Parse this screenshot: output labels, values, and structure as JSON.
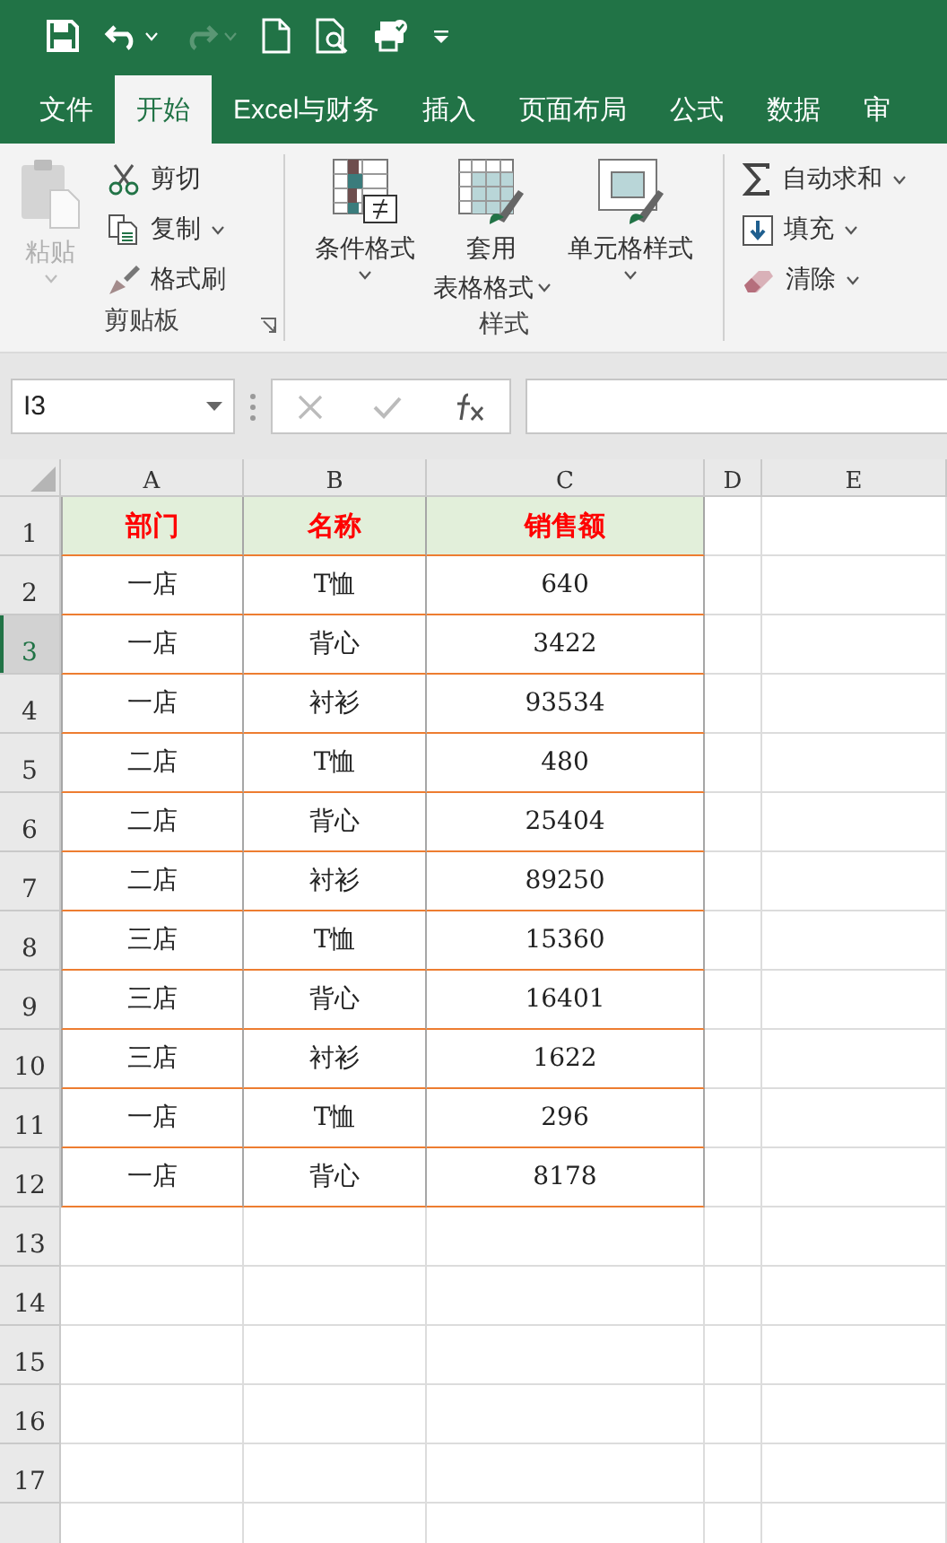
{
  "tabs": [
    {
      "label": "文件",
      "selected": false
    },
    {
      "label": "开始",
      "selected": true
    },
    {
      "label": "Excel与财务",
      "selected": false
    },
    {
      "label": "插入",
      "selected": false
    },
    {
      "label": "页面布局",
      "selected": false
    },
    {
      "label": "公式",
      "selected": false
    },
    {
      "label": "数据",
      "selected": false
    },
    {
      "label": "审",
      "selected": false
    }
  ],
  "ribbon": {
    "groups": [
      {
        "kind": "clipboard",
        "label": "剪贴板",
        "items": [
          {
            "lines": [
              "粘贴"
            ],
            "kind": "large",
            "disabled": true,
            "has_menu": true
          },
          {
            "lines": [
              "剪切"
            ],
            "kind": "small",
            "disabled": false,
            "has_menu": false
          },
          {
            "lines": [
              "复制"
            ],
            "kind": "small",
            "disabled": false,
            "has_menu": true
          },
          {
            "lines": [
              "格式刷"
            ],
            "kind": "small",
            "disabled": false,
            "has_menu": false
          }
        ]
      },
      {
        "kind": "styles",
        "label": "样式",
        "items": [
          {
            "lines": [
              "条件格式"
            ],
            "kind": "large",
            "disabled": false,
            "has_menu": true
          },
          {
            "lines": [
              "套用",
              "表格格式"
            ],
            "kind": "large",
            "disabled": false,
            "has_menu": true
          },
          {
            "lines": [
              "单元格样式"
            ],
            "kind": "large",
            "disabled": false,
            "has_menu": true
          }
        ]
      },
      {
        "kind": "editing",
        "items": [
          {
            "lines": [
              "自动求和"
            ],
            "kind": "small",
            "disabled": false,
            "has_menu": true
          },
          {
            "lines": [
              "填充"
            ],
            "kind": "small",
            "disabled": false,
            "has_menu": true
          },
          {
            "lines": [
              "清除"
            ],
            "kind": "small",
            "disabled": false,
            "has_menu": true
          }
        ]
      }
    ]
  },
  "formula_bar": {
    "name_box": "I3"
  },
  "sheet": {
    "columns": [
      "A",
      "B",
      "C",
      "D",
      "E"
    ],
    "rows": [
      {
        "number": "1",
        "header": true,
        "selected": false,
        "cells": [
          "部门",
          "名称",
          "销售额"
        ]
      },
      {
        "number": "2",
        "header": false,
        "selected": false,
        "cells": [
          "一店",
          "T恤",
          "640"
        ]
      },
      {
        "number": "3",
        "header": false,
        "selected": true,
        "cells": [
          "一店",
          "背心",
          "3422"
        ]
      },
      {
        "number": "4",
        "header": false,
        "selected": false,
        "cells": [
          "一店",
          "衬衫",
          "93534"
        ]
      },
      {
        "number": "5",
        "header": false,
        "selected": false,
        "cells": [
          "二店",
          "T恤",
          "480"
        ]
      },
      {
        "number": "6",
        "header": false,
        "selected": false,
        "cells": [
          "二店",
          "背心",
          "25404"
        ]
      },
      {
        "number": "7",
        "header": false,
        "selected": false,
        "cells": [
          "二店",
          "衬衫",
          "89250"
        ]
      },
      {
        "number": "8",
        "header": false,
        "selected": false,
        "cells": [
          "三店",
          "T恤",
          "15360"
        ]
      },
      {
        "number": "9",
        "header": false,
        "selected": false,
        "cells": [
          "三店",
          "背心",
          "16401"
        ]
      },
      {
        "number": "10",
        "header": false,
        "selected": false,
        "cells": [
          "三店",
          "衬衫",
          "1622"
        ]
      },
      {
        "number": "11",
        "header": false,
        "selected": false,
        "cells": [
          "一店",
          "T恤",
          "296"
        ]
      },
      {
        "number": "12",
        "header": false,
        "selected": false,
        "cells": [
          "一店",
          "背心",
          "8178"
        ]
      },
      {
        "number": "13",
        "header": false,
        "selected": false,
        "cells": []
      },
      {
        "number": "14",
        "header": false,
        "selected": false,
        "cells": []
      },
      {
        "number": "15",
        "header": false,
        "selected": false,
        "cells": []
      },
      {
        "number": "16",
        "header": false,
        "selected": false,
        "cells": []
      },
      {
        "number": "17",
        "header": false,
        "selected": false,
        "cells": []
      }
    ]
  }
}
